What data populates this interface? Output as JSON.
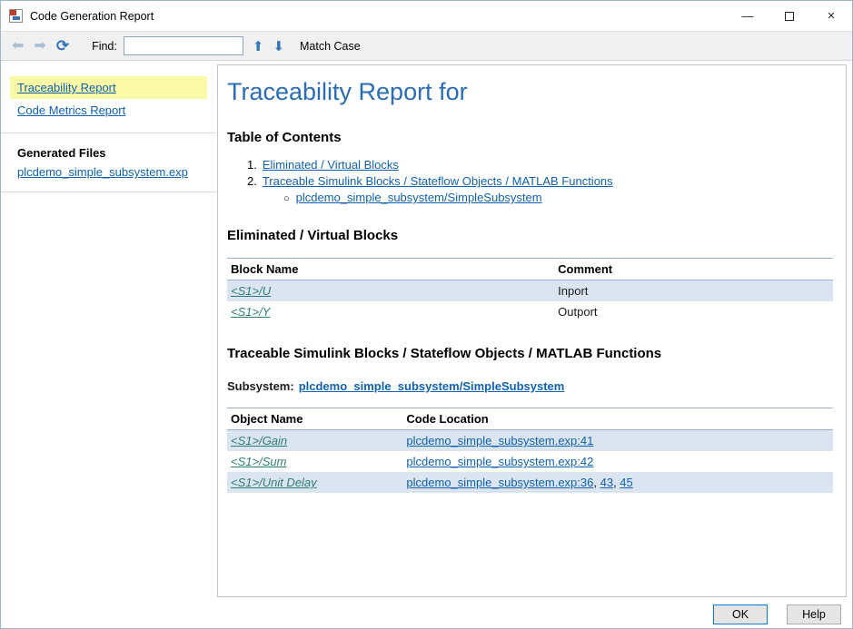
{
  "window": {
    "title": "Code Generation Report",
    "controls": {
      "minimize": "—",
      "close": "×"
    }
  },
  "toolbar": {
    "icons": {
      "back": "⬅",
      "forward": "➡",
      "refresh": "⟳",
      "up": "⬆",
      "down": "⬇"
    },
    "find_label": "Find:",
    "find_value": "",
    "match_case_label": "Match Case"
  },
  "sidebar": {
    "nav": [
      {
        "label": "Traceability Report"
      },
      {
        "label": "Code Metrics Report"
      }
    ],
    "generated_files_heading": "Generated Files",
    "files": [
      {
        "label": "plcdemo_simple_subsystem.exp"
      }
    ]
  },
  "content": {
    "title": "Traceability Report for",
    "toc_heading": "Table of Contents",
    "toc": [
      {
        "num": "1.",
        "label": "Eliminated / Virtual Blocks"
      },
      {
        "num": "2.",
        "label": "Traceable Simulink Blocks / Stateflow Objects / MATLAB Functions"
      }
    ],
    "toc_sub": [
      {
        "bullet": "○",
        "label": "plcdemo_simple_subsystem/SimpleSubsystem"
      }
    ],
    "section1": {
      "heading": "Eliminated / Virtual Blocks",
      "headers": [
        "Block Name",
        "Comment"
      ],
      "rows": [
        {
          "block": "<S1>/U",
          "comment": "Inport"
        },
        {
          "block": "<S1>/Y",
          "comment": "Outport"
        }
      ]
    },
    "section2": {
      "heading": "Traceable Simulink Blocks / Stateflow Objects / MATLAB Functions",
      "subsystem_label": "Subsystem:",
      "subsystem_link": "plcdemo_simple_subsystem/SimpleSubsystem",
      "headers": [
        "Object Name",
        "Code Location"
      ],
      "separator": ", ",
      "rows": [
        {
          "object": "<S1>/Gain",
          "location": "plcdemo_simple_subsystem.exp:41",
          "extra": []
        },
        {
          "object": "<S1>/Sum",
          "location": "plcdemo_simple_subsystem.exp:42",
          "extra": []
        },
        {
          "object": "<S1>/Unit Delay",
          "location": "plcdemo_simple_subsystem.exp:36",
          "extra": [
            "43",
            "45"
          ]
        }
      ]
    }
  },
  "footer": {
    "ok_label": "OK",
    "help_label": "Help"
  },
  "colors": {
    "accent_blue": "#2a6cb5",
    "link_blue": "#1061ae",
    "model_link_green": "#2e7d6f",
    "highlight_yellow": "#f9f9a6",
    "row_shade": "#dbe5f1",
    "table_rule": "#95b3d7",
    "ok_border": "#0078d7"
  }
}
